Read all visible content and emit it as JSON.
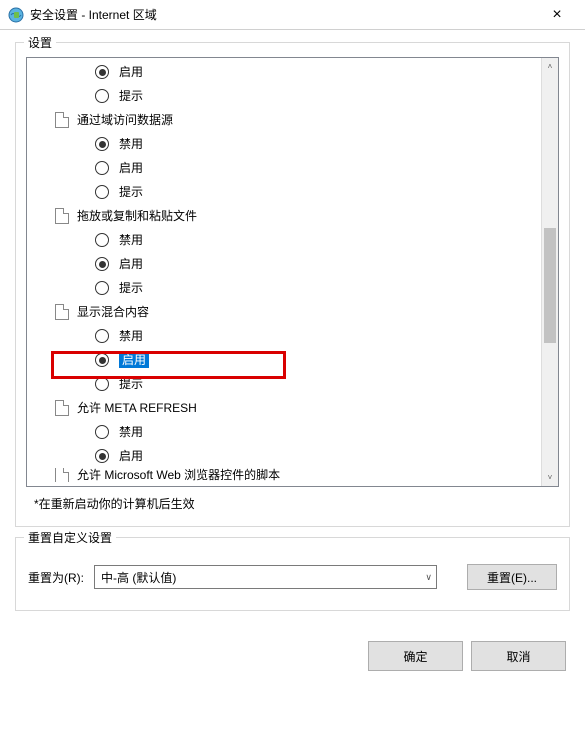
{
  "window": {
    "title": "安全设置 - Internet 区域",
    "close": "×"
  },
  "settings_group": {
    "legend": "设置"
  },
  "tree": {
    "nodes": [
      {
        "type": "radio",
        "label": "启用",
        "checked": true
      },
      {
        "type": "radio",
        "label": "提示",
        "checked": false
      },
      {
        "type": "group",
        "label": "通过域访问数据源"
      },
      {
        "type": "radio",
        "label": "禁用",
        "checked": true
      },
      {
        "type": "radio",
        "label": "启用",
        "checked": false
      },
      {
        "type": "radio",
        "label": "提示",
        "checked": false
      },
      {
        "type": "group",
        "label": "拖放或复制和粘贴文件"
      },
      {
        "type": "radio",
        "label": "禁用",
        "checked": false
      },
      {
        "type": "radio",
        "label": "启用",
        "checked": true
      },
      {
        "type": "radio",
        "label": "提示",
        "checked": false
      },
      {
        "type": "group",
        "label": "显示混合内容"
      },
      {
        "type": "radio",
        "label": "禁用",
        "checked": false
      },
      {
        "type": "radio",
        "label": "启用",
        "checked": true,
        "highlighted": true
      },
      {
        "type": "radio",
        "label": "提示",
        "checked": false
      },
      {
        "type": "group",
        "label": "允许 META REFRESH"
      },
      {
        "type": "radio",
        "label": "禁用",
        "checked": false
      },
      {
        "type": "radio",
        "label": "启用",
        "checked": true
      }
    ],
    "cutoff_label": "允许 Microsoft Web 浏览器控件的脚本"
  },
  "note": "*在重新启动你的计算机后生效",
  "reset_group": {
    "legend": "重置自定义设置",
    "label": "重置为(R):",
    "combo_value": "中-高 (默认值)",
    "reset_button": "重置(E)..."
  },
  "footer": {
    "ok": "确定",
    "cancel": "取消"
  }
}
